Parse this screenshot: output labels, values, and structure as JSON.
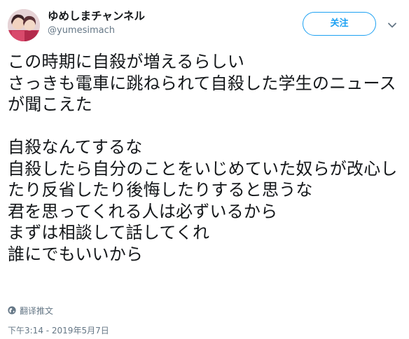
{
  "user": {
    "display_name": "ゆめしまチャンネル",
    "handle": "@yumesimach",
    "avatar_icon": "profile-photo"
  },
  "follow_button": {
    "label": "关注",
    "color": "#1da1f2"
  },
  "menu_icon": "chevron-down-icon",
  "tweet": {
    "text": "この時期に自殺が増えるらしい\nさっきも電車に跳ねられて自殺した学生のニュースが聞こえた\n\n自殺なんてするな\n自殺したら自分のことをいじめていた奴らが改心したり反省したり後悔したりすると思うな\n君を思ってくれる人は必ずいるから\nまずは相談して話してくれ\n誰にでもいいから"
  },
  "translate": {
    "icon": "globe-icon",
    "label": "翻译推文"
  },
  "timestamp": "下午3:14 - 2019年5月7日",
  "colors": {
    "text": "#14171a",
    "secondary": "#657786",
    "accent": "#1da1f2"
  }
}
